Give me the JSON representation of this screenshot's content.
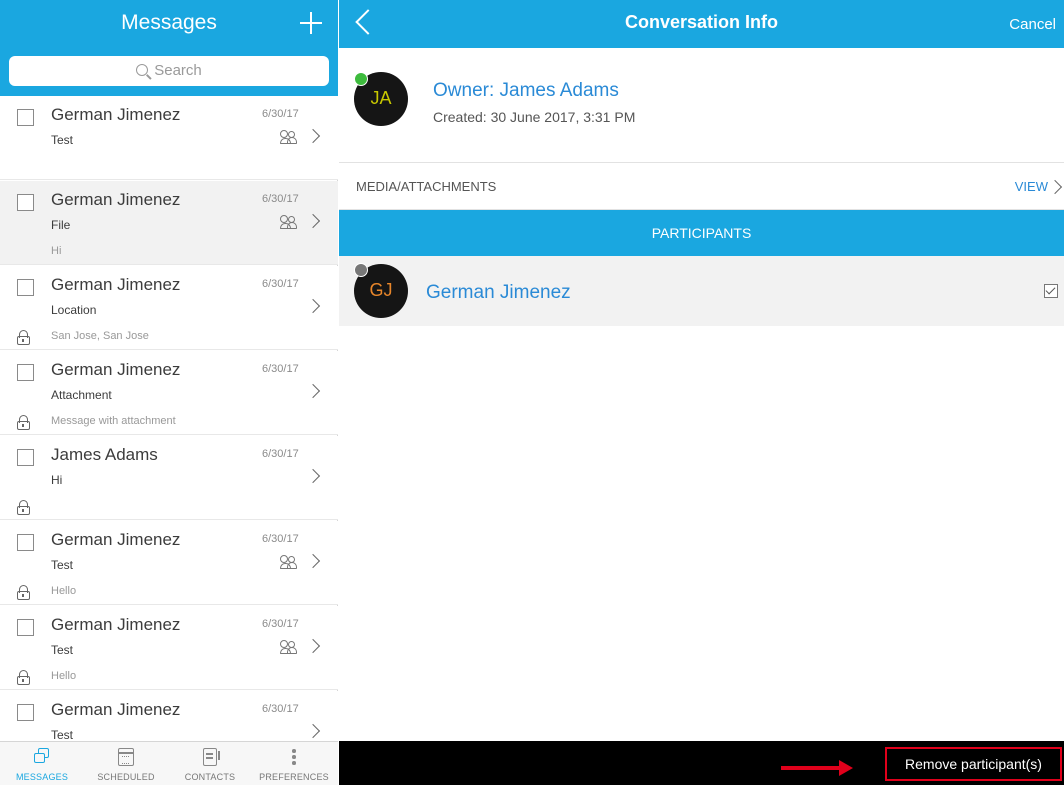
{
  "messages_pane": {
    "title": "Messages",
    "search_placeholder": "Search",
    "items": [
      {
        "name": "German Jimenez",
        "date": "6/30/17",
        "subject": "Test",
        "preview": "",
        "group": true,
        "locked": false,
        "selected": false
      },
      {
        "name": "German Jimenez",
        "date": "6/30/17",
        "subject": "File",
        "preview": "Hi",
        "group": true,
        "locked": false,
        "selected": true
      },
      {
        "name": "German Jimenez",
        "date": "6/30/17",
        "subject": "Location",
        "preview": "San Jose, San Jose",
        "group": false,
        "locked": true,
        "selected": false
      },
      {
        "name": "German Jimenez",
        "date": "6/30/17",
        "subject": "Attachment",
        "preview": "Message with attachment",
        "group": false,
        "locked": true,
        "selected": false
      },
      {
        "name": "James Adams",
        "date": "6/30/17",
        "subject": "Hi",
        "preview": "",
        "group": false,
        "locked": true,
        "selected": false
      },
      {
        "name": "German Jimenez",
        "date": "6/30/17",
        "subject": "Test",
        "preview": "Hello",
        "group": true,
        "locked": true,
        "selected": false
      },
      {
        "name": "German Jimenez",
        "date": "6/30/17",
        "subject": "Test",
        "preview": "Hello",
        "group": true,
        "locked": true,
        "selected": false
      },
      {
        "name": "German Jimenez",
        "date": "6/30/17",
        "subject": "Test",
        "preview": "",
        "group": false,
        "locked": false,
        "selected": false
      }
    ],
    "tabs": [
      {
        "label": "MESSAGES",
        "icon": "messages-icon",
        "active": true
      },
      {
        "label": "SCHEDULED",
        "icon": "calendar-icon",
        "active": false
      },
      {
        "label": "CONTACTS",
        "icon": "contacts-icon",
        "active": false
      },
      {
        "label": "PREFERENCES",
        "icon": "more-icon",
        "active": false
      }
    ]
  },
  "conversation_info": {
    "title": "Conversation Info",
    "cancel_label": "Cancel",
    "owner": {
      "initials": "JA",
      "label": "Owner: James Adams",
      "created": "Created: 30 June 2017, 3:31 PM",
      "status_color": "#3dbb3d"
    },
    "media_label": "MEDIA/ATTACHMENTS",
    "view_label": "VIEW",
    "participants_label": "PARTICIPANTS",
    "participants": [
      {
        "initials": "GJ",
        "name": "German Jimenez",
        "checked": true,
        "status_color": "#777777"
      }
    ],
    "remove_button": "Remove participant(s)"
  },
  "colors": {
    "accent": "#1aa7e0",
    "link": "#2a8ad6",
    "highlight": "#e0001b"
  }
}
